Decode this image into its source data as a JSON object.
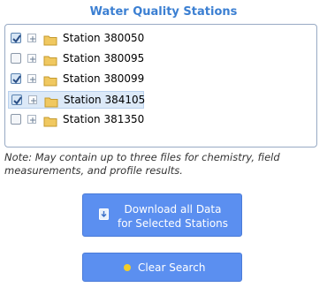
{
  "title": "Water Quality Stations",
  "stations": [
    {
      "label": "Station 380050",
      "checked": true,
      "selected": false
    },
    {
      "label": "Station 380095",
      "checked": false,
      "selected": false
    },
    {
      "label": "Station 380099",
      "checked": true,
      "selected": false
    },
    {
      "label": "Station 384105",
      "checked": true,
      "selected": true
    },
    {
      "label": "Station 381350",
      "checked": false,
      "selected": false
    }
  ],
  "note": "Note: May contain up to three files for chemistry, field measurements, and profile results.",
  "download_button": {
    "line1": "Download all Data",
    "line2": "for Selected Stations"
  },
  "clear_button": {
    "label": "Clear Search"
  },
  "colors": {
    "title": "#3b7fd2",
    "button": "#5b8ff0",
    "folder": "#f0c860",
    "clear_icon": "#f2cd2a"
  }
}
